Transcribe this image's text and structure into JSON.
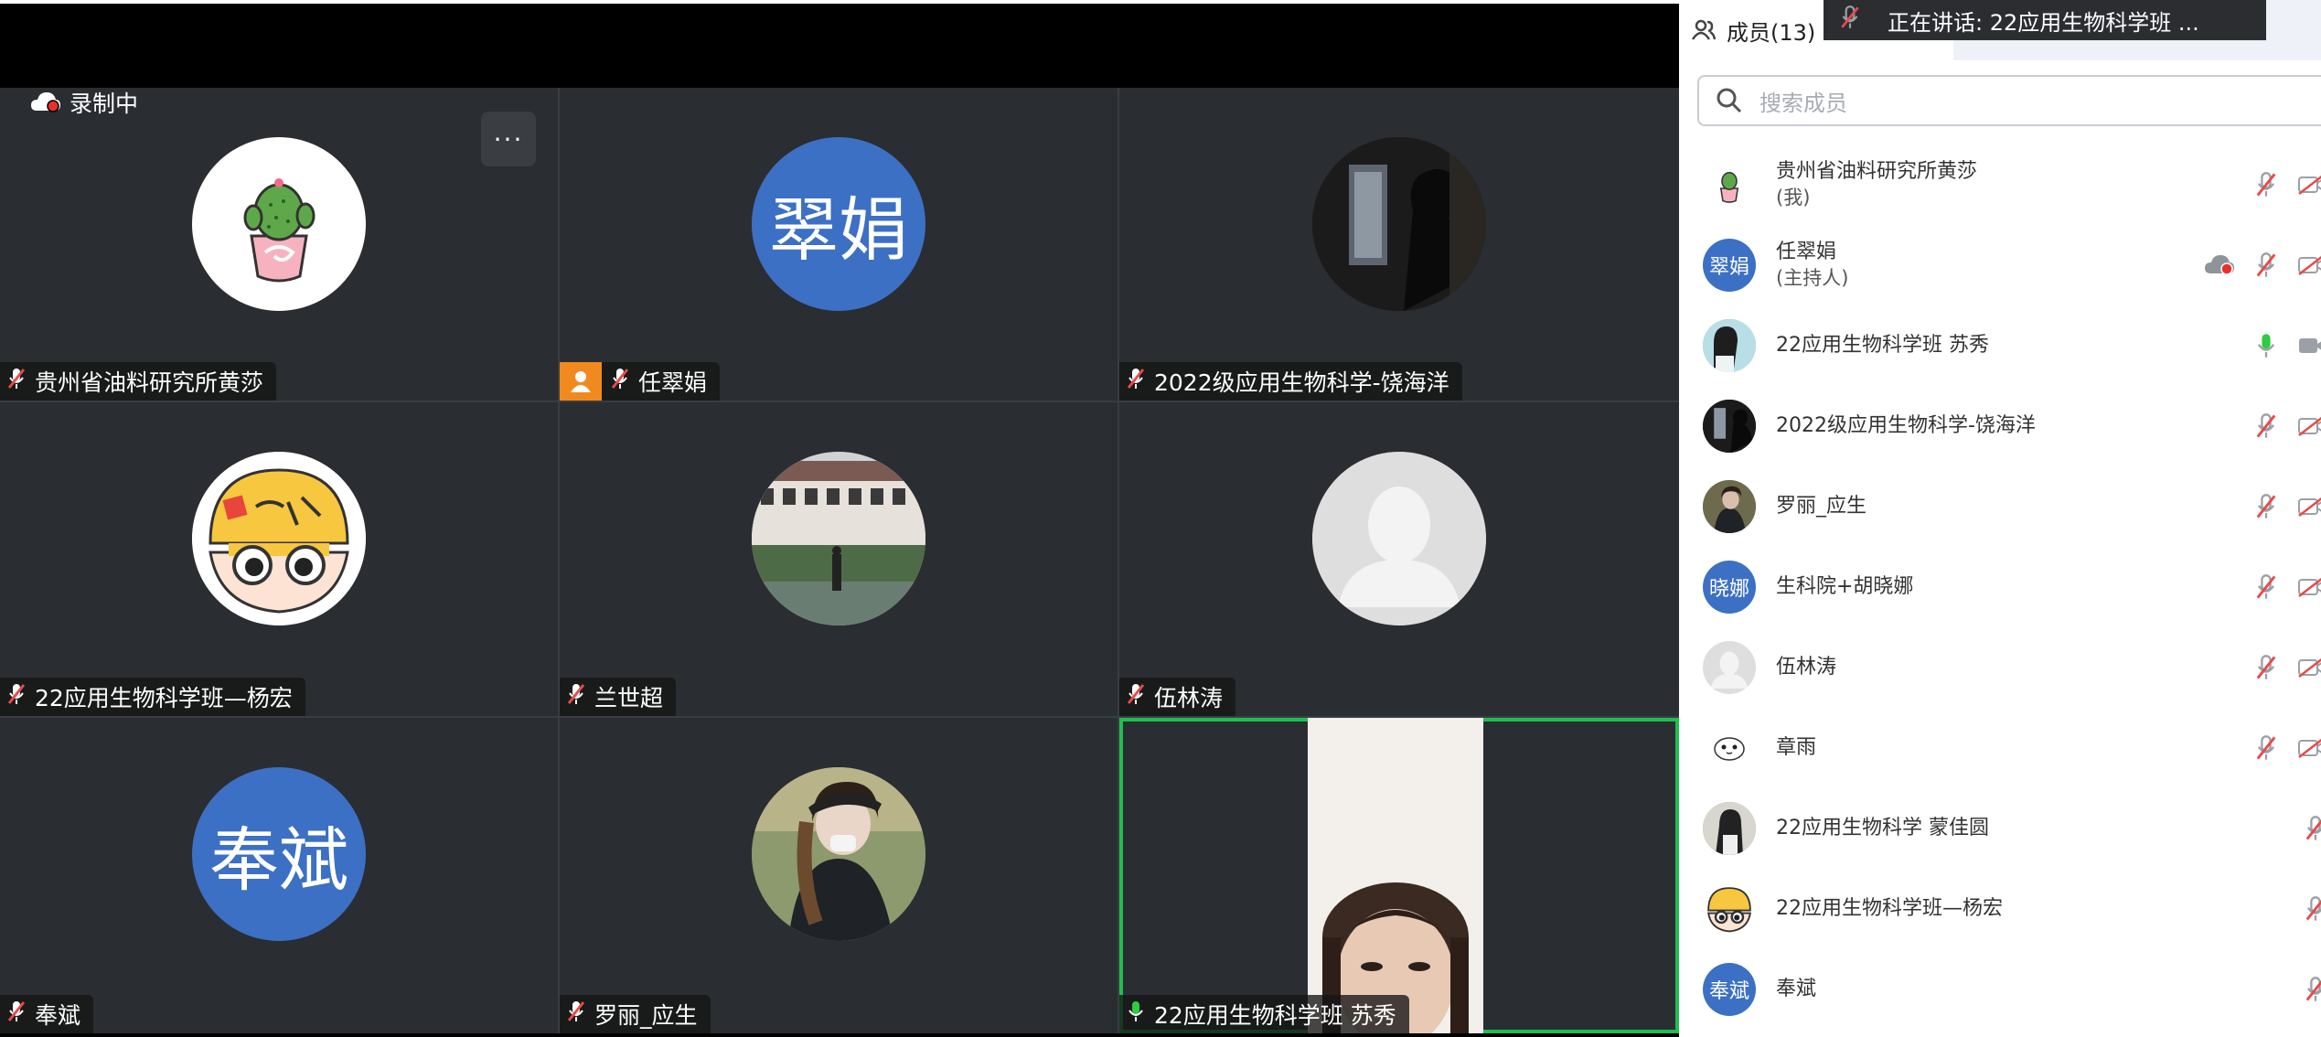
{
  "recording": {
    "label": "录制中"
  },
  "more_button": {
    "label": "···"
  },
  "tiles": [
    {
      "name": "贵州省油料研究所黄莎",
      "avatar_type": "image-cactus",
      "mic": "muted",
      "host": false
    },
    {
      "name": "任翠娟",
      "avatar_type": "text",
      "avatar_text": "翠娟",
      "mic": "muted",
      "host": true
    },
    {
      "name": "2022级应用生物科学-饶海洋",
      "avatar_type": "image-dark",
      "mic": "muted",
      "host": false
    },
    {
      "name": "22应用生物科学班—杨宏",
      "avatar_type": "image-cartoon",
      "mic": "muted",
      "host": false
    },
    {
      "name": "兰世超",
      "avatar_type": "image-photo",
      "mic": "muted",
      "host": false
    },
    {
      "name": "伍林涛",
      "avatar_type": "default-silhouette",
      "mic": "muted",
      "host": false
    },
    {
      "name": "奉斌",
      "avatar_type": "text",
      "avatar_text": "奉斌",
      "mic": "muted",
      "host": false
    },
    {
      "name": "罗丽_应生",
      "avatar_type": "image-photo",
      "mic": "muted",
      "host": false
    },
    {
      "name": "22应用生物科学班 苏秀",
      "avatar_type": "video",
      "mic": "active",
      "host": false,
      "speaking": true
    }
  ],
  "sidebar": {
    "tab_label": "成员(13)",
    "speaking_banner": "正在讲话:  22应用生物科学班 ...",
    "search_placeholder": "搜索成员",
    "members": [
      {
        "name": "贵州省油料研究所黄莎",
        "sub": "(我)",
        "avatar_type": "image-cactus",
        "mic": "muted",
        "video": "off"
      },
      {
        "name": "任翠娟",
        "sub": "(主持人)",
        "avatar_type": "text",
        "avatar_text": "翠娟",
        "mic": "muted",
        "video": "off",
        "recording": true
      },
      {
        "name": "22应用生物科学班 苏秀",
        "sub": "",
        "avatar_type": "image-photo",
        "mic": "active",
        "video": "on"
      },
      {
        "name": "2022级应用生物科学-饶海洋",
        "sub": "",
        "avatar_type": "image-dark",
        "mic": "muted",
        "video": "off"
      },
      {
        "name": "罗丽_应生",
        "sub": "",
        "avatar_type": "image-photo",
        "mic": "muted",
        "video": "off"
      },
      {
        "name": "生科院+胡晓娜",
        "sub": "",
        "avatar_type": "text",
        "avatar_text": "晓娜",
        "mic": "muted",
        "video": "off"
      },
      {
        "name": "伍林涛",
        "sub": "",
        "avatar_type": "default-silhouette",
        "mic": "muted",
        "video": "off"
      },
      {
        "name": "章雨",
        "sub": "",
        "avatar_type": "image-sketch",
        "mic": "muted",
        "video": "off"
      },
      {
        "name": "22应用生物科学 蒙佳圆",
        "sub": "",
        "avatar_type": "image-photo",
        "mic": "muted",
        "video": "none"
      },
      {
        "name": "22应用生物科学班—杨宏",
        "sub": "",
        "avatar_type": "image-cartoon",
        "mic": "muted",
        "video": "none"
      },
      {
        "name": "奉斌",
        "sub": "",
        "avatar_type": "text",
        "avatar_text": "奉斌",
        "mic": "muted",
        "video": "none"
      }
    ]
  },
  "colors": {
    "speaking_border": "#1fbf4f",
    "avatar_blue": "#3c70c4",
    "host_badge": "#f08a1e",
    "mic_muted": "#e84a4a",
    "mic_active": "#2ecc40"
  }
}
